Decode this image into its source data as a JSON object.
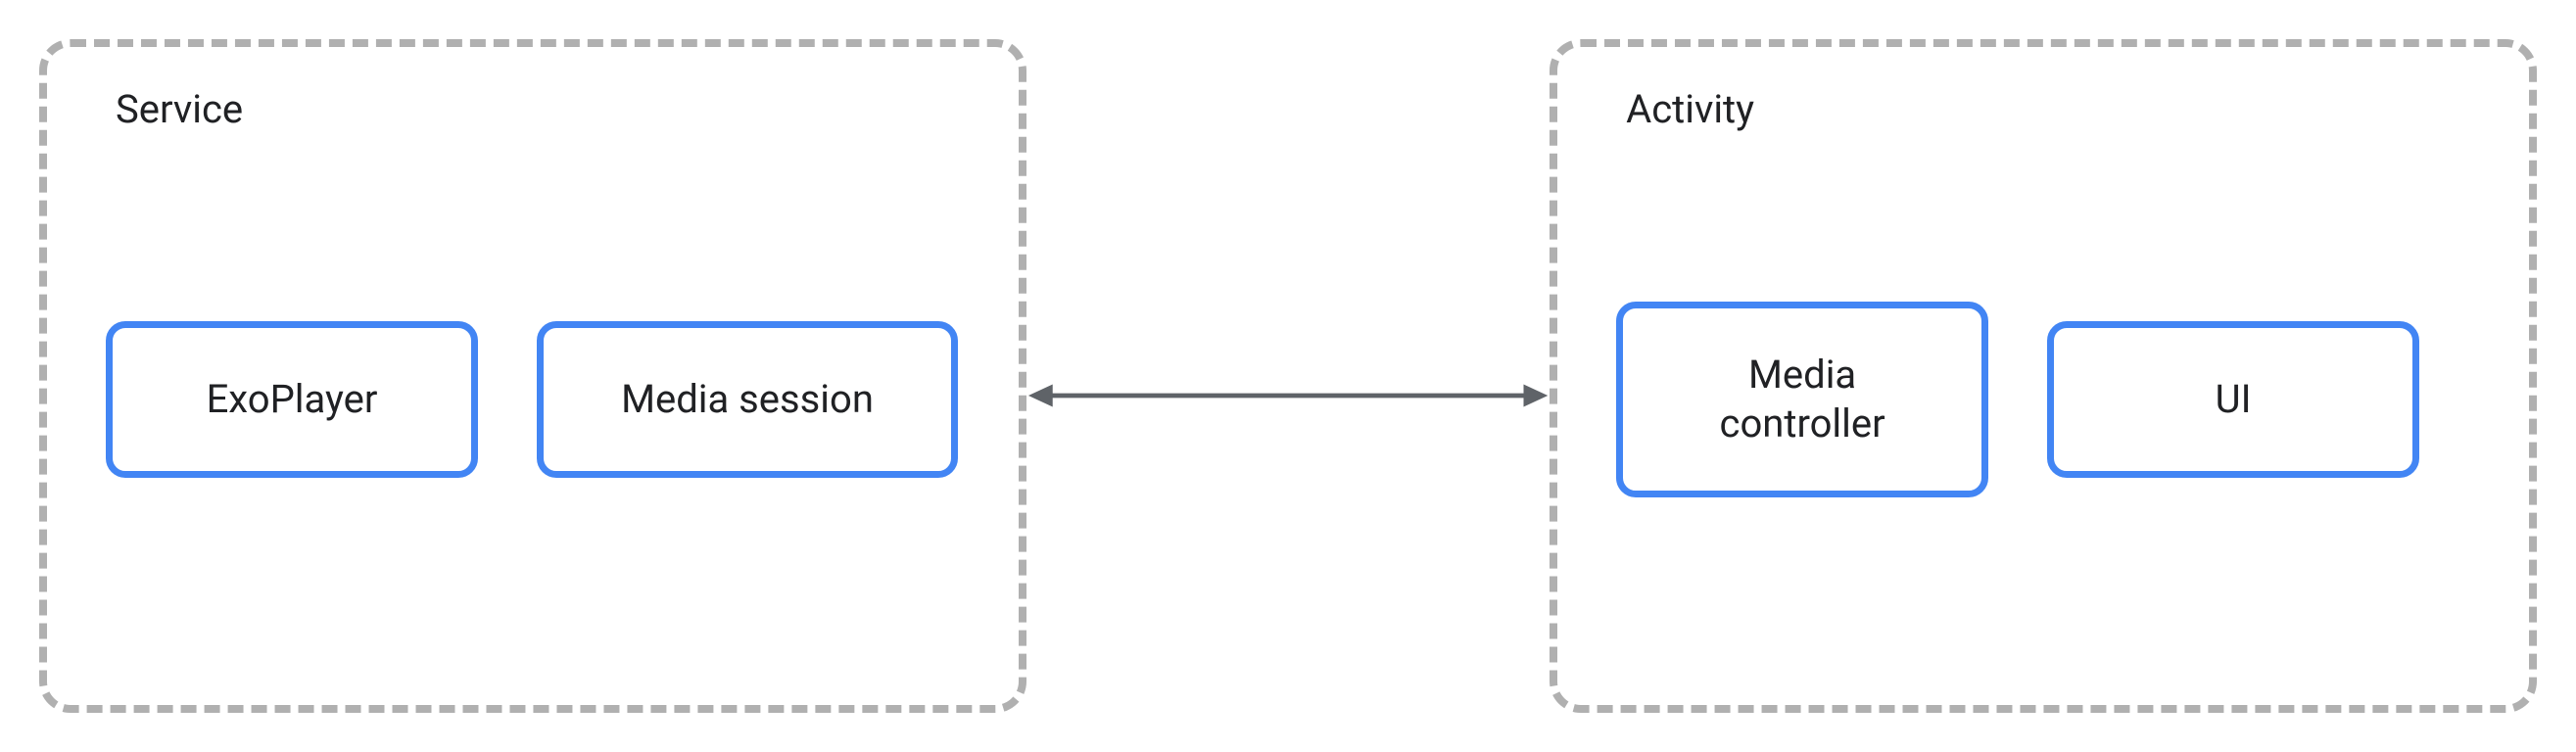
{
  "diagram": {
    "left_container": {
      "label": "Service",
      "nodes": [
        {
          "id": "exoplayer",
          "label": "ExoPlayer"
        },
        {
          "id": "mediasession",
          "label": "Media session"
        }
      ]
    },
    "right_container": {
      "label": "Activity",
      "nodes": [
        {
          "id": "mediacontroller",
          "label": "Media\ncontroller"
        },
        {
          "id": "ui",
          "label": "UI"
        }
      ]
    },
    "connector": {
      "type": "bidirectional-arrow",
      "from": "mediasession",
      "to": "mediacontroller"
    }
  },
  "colors": {
    "node_border": "#4285f4",
    "dashed_border": "#b0b0b0",
    "text": "#202124",
    "arrow": "#5f6368"
  }
}
